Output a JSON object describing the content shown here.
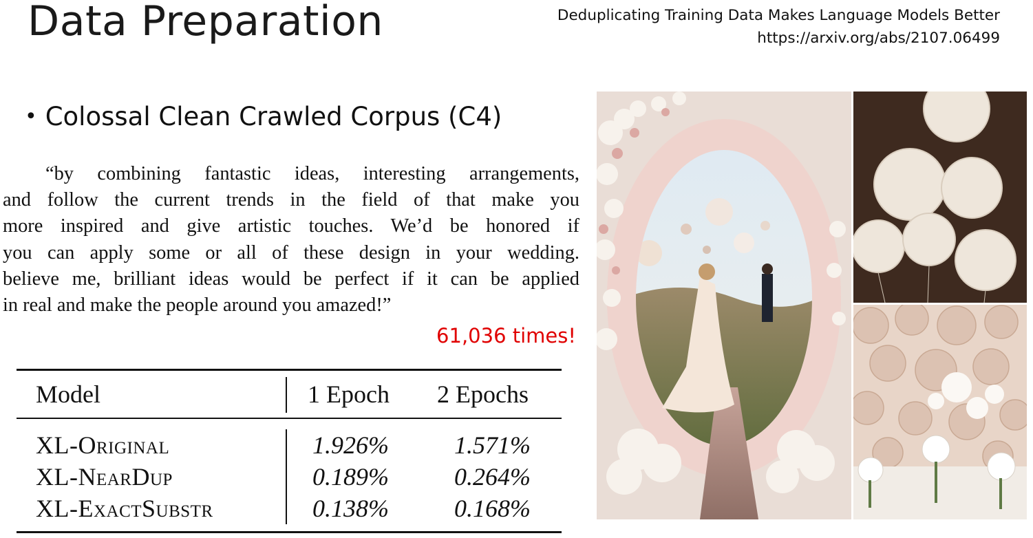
{
  "slide": {
    "title": "Data Preparation",
    "reference_title": "Deduplicating Training Data Makes Language Models Better",
    "reference_url": "https://arxiv.org/abs/2107.06499",
    "bullet": "Colossal Clean Crawled Corpus (C4)",
    "quote_lines": [
      "“by combining fantastic ideas, interesting arrangements,",
      "and follow the current trends in the field of that make you",
      "more inspired and give artistic touches. We’d be honored if",
      "you can apply some or all of these design in your wedding.",
      "believe me, brilliant ideas would be perfect if it can be applied",
      "in real and make the people around you amazed!”"
    ],
    "count": "61,036 times!"
  },
  "table": {
    "headers": [
      "Model",
      "1 Epoch",
      "2 Epochs"
    ],
    "rows": [
      {
        "model": "XL-Original",
        "epoch1": "1.926%",
        "epoch2": "1.571%"
      },
      {
        "model": "XL-NearDup",
        "epoch1": "0.189%",
        "epoch2": "0.264%"
      },
      {
        "model": "XL-ExactSubstr",
        "epoch1": "0.138%",
        "epoch2": "0.168%"
      }
    ]
  },
  "colors": {
    "accent_red": "#e00000",
    "text": "#111111"
  }
}
